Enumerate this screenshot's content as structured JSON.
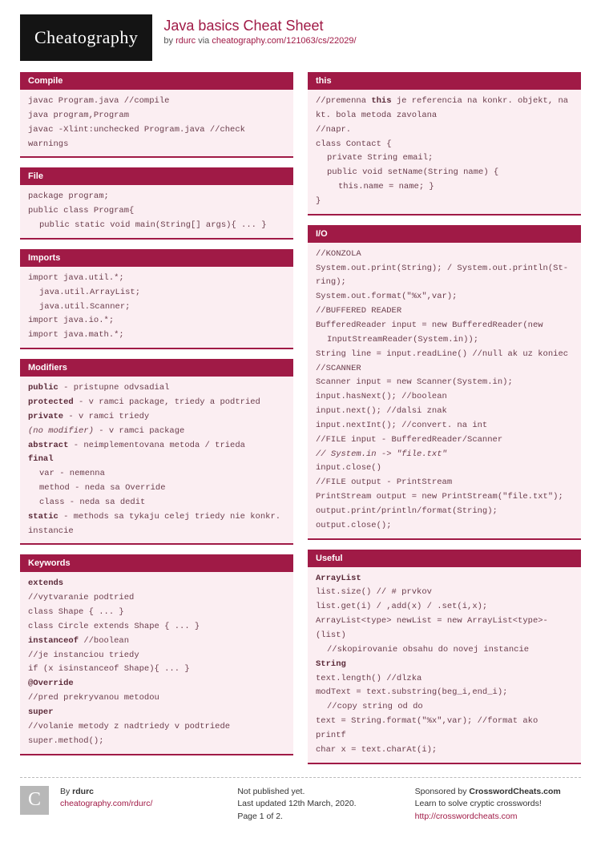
{
  "header": {
    "logo": "Cheatography",
    "title": "Java basics Cheat Sheet",
    "by": "by ",
    "author": "rdurc",
    "via": " via ",
    "url": "cheatography.com/121063/cs/22029/"
  },
  "left": [
    {
      "title": "Compile",
      "lines": [
        {
          "t": "javac Program.java //compile"
        },
        {
          "t": "java program,Program"
        },
        {
          "t": "javac -Xlint:unchecked Program.java //check"
        },
        {
          "t": "warnings"
        }
      ]
    },
    {
      "title": "File",
      "lines": [
        {
          "t": "package program;"
        },
        {
          "t": "public class Program{"
        },
        {
          "t": "public static void main(String[] args){ ... }",
          "i": 1
        }
      ]
    },
    {
      "title": "Imports",
      "lines": [
        {
          "t": "import java.util.*;"
        },
        {
          "t": "java.util.ArrayList;",
          "i": 1
        },
        {
          "t": "java.util.Scanner;",
          "i": 1
        },
        {
          "t": "import java.io.*;"
        },
        {
          "t": "import java.math.*;"
        }
      ]
    },
    {
      "title": "Modifiers",
      "lines": [
        {
          "html": "<strong>public</strong> - pristupne odvsadial"
        },
        {
          "html": "<strong>protected</strong> - v ramci package, triedy a podtried"
        },
        {
          "html": "<strong>private</strong> - v ramci triedy"
        },
        {
          "html": "<em>(no modifier)</em> - v ramci package"
        },
        {
          "html": "<strong>abstract</strong> - neimplementovana metoda / trieda"
        },
        {
          "html": "<strong>final</strong>"
        },
        {
          "t": "var - nemenna",
          "i": 1
        },
        {
          "t": "method - neda sa Override",
          "i": 1
        },
        {
          "t": "class - neda sa dedit",
          "i": 1
        },
        {
          "html": "<strong>static</strong> - methods sa tykaju celej triedy nie konkr."
        },
        {
          "t": "instancie"
        }
      ]
    },
    {
      "title": "Keywords",
      "lines": [
        {
          "html": "<strong>extends</strong>"
        },
        {
          "t": "//vytvaranie podtried"
        },
        {
          "t": "class Shape { ... }"
        },
        {
          "t": "class Circle extends Shape { ... }"
        },
        {
          "html": "<strong>instanceof</strong> //boolean"
        },
        {
          "t": "//je instanciou triedy"
        },
        {
          "t": "if (x isinstanceof Shape){ ... }"
        },
        {
          "html": "<strong>@Override</strong>"
        },
        {
          "t": "//pred prekryvanou metodou"
        },
        {
          "html": "<strong>super</strong>"
        },
        {
          "t": "//volanie metody z nadtriedy v podtriede"
        },
        {
          "t": "super.method();"
        }
      ]
    }
  ],
  "right": [
    {
      "title": "this",
      "lines": [
        {
          "html": "//premenna <strong>this</strong> je referencia na konkr. objekt, na"
        },
        {
          "t": "kt. bola metoda zavolana"
        },
        {
          "t": "//napr."
        },
        {
          "t": "class Contact {"
        },
        {
          "t": "private String email;",
          "i": 1
        },
        {
          "t": "public void setName(String name) {",
          "i": 1
        },
        {
          "t": "this.name = name; }",
          "i": 2
        },
        {
          "t": "}"
        }
      ]
    },
    {
      "title": "I/O",
      "lines": [
        {
          "t": "//KONZOLA"
        },
        {
          "t": "System.out.print(String); / System.out.println(St-"
        },
        {
          "t": "ring);"
        },
        {
          "t": "System.out.format(\"%x\",var);"
        },
        {
          "t": "//BUFFERED READER"
        },
        {
          "t": "BufferedReader input = new BufferedReader(new"
        },
        {
          "t": "InputStreamReader(System.in));",
          "i": 1
        },
        {
          "t": "String line = input.readLine() //null ak uz koniec"
        },
        {
          "t": "//SCANNER"
        },
        {
          "t": "Scanner input = new Scanner(System.in);"
        },
        {
          "t": "input.hasNext(); //boolean"
        },
        {
          "t": "input.next(); //dalsi znak"
        },
        {
          "t": "input.nextInt(); //convert. na int"
        },
        {
          "t": "//FILE input - BufferedReader/Scanner"
        },
        {
          "html": "<em>// System.in -> \"file.txt\"</em>"
        },
        {
          "t": "input.close()"
        },
        {
          "t": "//FILE output - PrintStream"
        },
        {
          "t": "PrintStream output = new PrintStream(\"file.txt\");"
        },
        {
          "t": "output.print/println/format(String);"
        },
        {
          "t": "output.close();"
        }
      ]
    },
    {
      "title": "Useful",
      "lines": [
        {
          "html": "<strong>ArrayList</strong>"
        },
        {
          "t": "list.size() // # prvkov"
        },
        {
          "t": "list.get(i) / ,add(x) / .set(i,x);"
        },
        {
          "t": "ArrayList<type> newList = new ArrayList<type>-"
        },
        {
          "t": "(list)"
        },
        {
          "t": "//skopirovanie obsahu do novej instancie",
          "i": 1
        },
        {
          "html": "<strong>String</strong>"
        },
        {
          "t": "text.length() //dlzka"
        },
        {
          "t": "modText = text.substring(beg_i,end_i);"
        },
        {
          "t": "//copy string od do",
          "i": 1
        },
        {
          "t": "text = String.format(\"%x\",var); //format ako printf"
        },
        {
          "t": "char x = text.charAt(i);"
        }
      ]
    }
  ],
  "footer": {
    "col1": {
      "by": "By ",
      "author": "rdurc",
      "url": "cheatography.com/rdurc/"
    },
    "col2": {
      "l1": "Not published yet.",
      "l2": "Last updated 12th March, 2020.",
      "l3": "Page 1 of 2."
    },
    "col3": {
      "l1a": "Sponsored by ",
      "l1b": "CrosswordCheats.com",
      "l2": "Learn to solve cryptic crosswords!",
      "url": "http://crosswordcheats.com"
    }
  }
}
